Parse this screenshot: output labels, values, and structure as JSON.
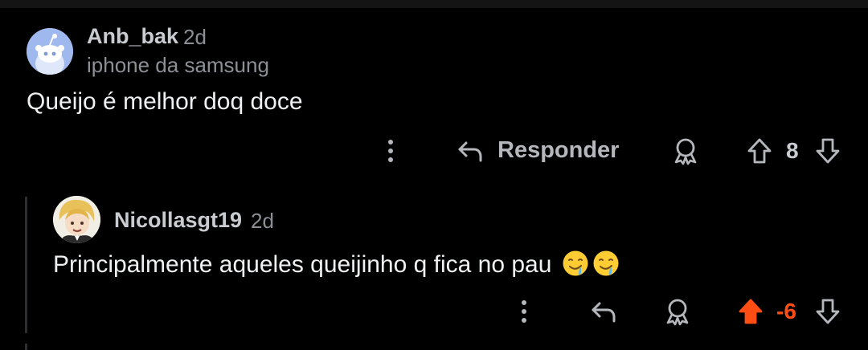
{
  "comment1": {
    "author": "Anb_bak",
    "time": "2d",
    "flair": "iphone da samsung",
    "body": "Queijo é melhor doq doce",
    "reply_label": "Responder",
    "score": "8"
  },
  "comment2": {
    "author": "Nicollasgt19",
    "time": "2d",
    "body": "Principalmente aqueles queijinho q fica no pau",
    "score": "-6"
  },
  "colors": {
    "background": "#000000",
    "upvoted": "#ff4d14",
    "muted_text": "#8c9096",
    "icon": "#b4b8bd"
  },
  "icons": [
    "more-vertical-icon",
    "reply-icon",
    "award-icon",
    "upvote-icon",
    "downvote-icon",
    "drooling-face-emoji"
  ]
}
